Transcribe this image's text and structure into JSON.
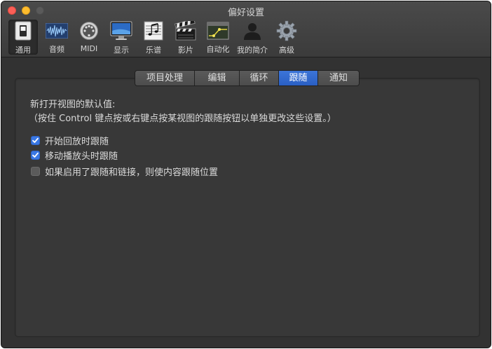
{
  "window": {
    "title": "偏好设置"
  },
  "toolbar": {
    "items": [
      {
        "label": "通用",
        "icon": "general-switch-icon",
        "selected": true
      },
      {
        "label": "音频",
        "icon": "audio-waveform-icon"
      },
      {
        "label": "MIDI",
        "icon": "midi-connector-icon"
      },
      {
        "label": "显示",
        "icon": "display-monitor-icon"
      },
      {
        "label": "乐谱",
        "icon": "score-notation-icon"
      },
      {
        "label": "影片",
        "icon": "clapperboard-icon"
      },
      {
        "label": "自动化",
        "icon": "automation-curve-icon"
      },
      {
        "label": "我的简介",
        "icon": "profile-person-icon"
      },
      {
        "label": "高级",
        "icon": "gear-icon"
      }
    ]
  },
  "tabs": [
    {
      "label": "项目处理"
    },
    {
      "label": "编辑"
    },
    {
      "label": "循环"
    },
    {
      "label": "跟随",
      "active": true
    },
    {
      "label": "通知"
    }
  ],
  "follow": {
    "heading": "新打开视图的默认值:",
    "note": "（按住 Control 键点按或右键点按某视图的跟随按钮以单独更改这些设置。）",
    "options": [
      {
        "label": "开始回放时跟随",
        "checked": true
      },
      {
        "label": "移动播放头时跟随",
        "checked": true
      },
      {
        "label": "如果启用了跟随和链接，则使内容跟随位置",
        "checked": false
      }
    ]
  },
  "colors": {
    "accent": "#3a78e4",
    "window_bg": "#323232",
    "panel_bg": "#383838",
    "close": "#fc5f57",
    "minimize": "#fdbc2e"
  }
}
